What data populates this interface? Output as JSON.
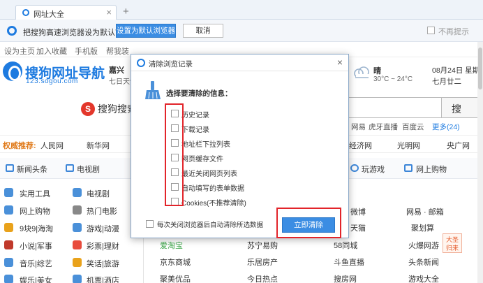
{
  "browser": {
    "tab_title": "网址大全",
    "tab_close": "×",
    "new_tab": "+"
  },
  "default_bar": {
    "message": "把搜狗高速浏览器设为默认？",
    "set_default_label": "设置为默认浏览器",
    "cancel_label": "取消",
    "no_prompt_label": "不再提示"
  },
  "link_bar": [
    "设为主页",
    "加入收藏",
    "手机版",
    "帮我装"
  ],
  "header": {
    "logo_title": "搜狗网址导航",
    "logo_url": "123.sogou.com",
    "city": "嘉兴",
    "city_sub": "七日天气",
    "weather": "晴",
    "temp_range": "30°C ~ 24°C",
    "date": "08月24日 星期",
    "lunar": "七月廿二"
  },
  "search": {
    "brand": "S",
    "brand_label": "搜狗搜索",
    "button_label": "搜",
    "hot_words": [
      "网易",
      "虎牙直播",
      "百度云",
      "更多(24)"
    ]
  },
  "recommend": {
    "label": "权威推荐:",
    "items": [
      "人民网",
      "新华网",
      "经济网",
      "光明网",
      "央广网"
    ]
  },
  "nav": {
    "items": [
      "新闻头条",
      "电视剧",
      "玩游戏",
      "网上购物"
    ]
  },
  "categories": [
    {
      "left": "实用工具",
      "right": "电视剧",
      "color_l": "#4a90d9",
      "color_r": "#4a90d9"
    },
    {
      "left": "网上购物",
      "right": "热门电影",
      "color_l": "#4a90d9",
      "color_r": "#888888"
    },
    {
      "left": "9块9|海淘",
      "right": "游戏|动漫",
      "color_l": "#e9a21b",
      "color_r": "#4a90d9"
    },
    {
      "left": "小说|军事",
      "right": "彩票|理财",
      "color_l": "#c0392b",
      "color_r": "#e84c3d"
    },
    {
      "left": "音乐|综艺",
      "right": "笑话|旅游",
      "color_l": "#4a90d9",
      "color_r": "#e9a21b"
    },
    {
      "left": "娱乐|美女",
      "right": "机票|酒店",
      "color_l": "#4a90d9",
      "color_r": "#4a90d9"
    }
  ],
  "grid": {
    "rows": [
      [
        "微博",
        "网易 · 邮箱"
      ],
      [
        "天猫",
        "聚划算"
      ],
      [
        "爱淘宝",
        "苏宁易购",
        "58同城",
        "火爆网游"
      ],
      [
        "京东商城",
        "乐居房产",
        "斗鱼直播",
        "头条新闻"
      ],
      [
        "聚美优品",
        "今日热点",
        "搜房网",
        "游戏大全"
      ]
    ],
    "ad_tag": "大圣 归来"
  },
  "dialog": {
    "title": "清除浏览记录",
    "close": "×",
    "prompt": "选择要清除的信息：",
    "options": [
      "历史记录",
      "下载记录",
      "地址栏下拉列表",
      "网页缓存文件",
      "最近关闭网页列表",
      "自动填写的表单数据",
      "Cookies(不推荐清除)"
    ],
    "auto_clear_label": "每次关闭浏览器后自动清除所选数据",
    "clear_button": "立即清除"
  },
  "colors": {
    "accent": "#3b8de3",
    "highlight": "#e2242a"
  }
}
